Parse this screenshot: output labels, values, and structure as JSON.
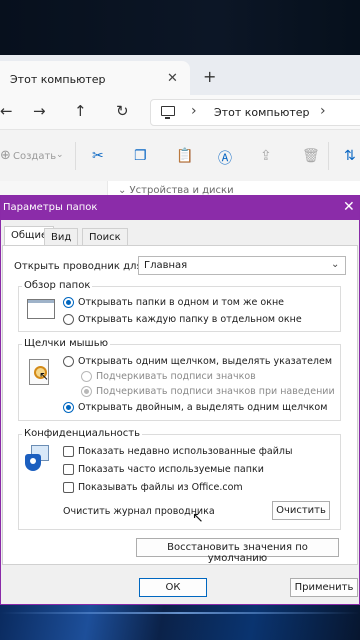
{
  "explorer": {
    "tab_title": "Этот компьютер",
    "tab_close": "✕",
    "new_tab": "+",
    "nav": {
      "back": "←",
      "forward": "→",
      "up": "↑",
      "refresh": "↻"
    },
    "address": {
      "separator": "›",
      "location": "Этот компьютер"
    },
    "toolbar": {
      "create_label": "Создать",
      "icons": [
        "cut-icon",
        "copy-icon",
        "paste-icon",
        "rename-icon",
        "share-icon",
        "delete-icon",
        "sort-icon"
      ]
    },
    "devices_label": "⌄ Устройства и диски"
  },
  "dialog": {
    "title": "Параметры папок",
    "close": "✕",
    "tabs": [
      "Общие",
      "Вид",
      "Поиск"
    ],
    "open_explorer_label": "Открыть проводник для:",
    "open_explorer_value": "Главная",
    "browse_group": {
      "title": "Обзор папок",
      "options": [
        {
          "label": "Открывать папки в одном и том же окне",
          "checked": true
        },
        {
          "label": "Открывать каждую папку в отдельном окне",
          "checked": false
        }
      ]
    },
    "click_group": {
      "title": "Щелчки мышью",
      "single_click": "Открывать одним щелчком, выделять указателем",
      "underline_always": "Подчеркивать подписи значков",
      "underline_hover": "Подчеркивать подписи значков при наведении",
      "double_click": "Открывать двойным, а выделять одним щелчком",
      "selected": "double_click"
    },
    "privacy_group": {
      "title": "Конфиденциальность",
      "options": [
        {
          "label": "Показать недавно использованные файлы",
          "checked": false
        },
        {
          "label": "Показать часто используемые папки",
          "checked": false
        },
        {
          "label": "Показывать файлы из Office.com",
          "checked": false
        }
      ],
      "clear_label": "Очистить журнал проводника",
      "clear_button": "Очистить"
    },
    "restore_defaults": "Восстановить значения по умолчанию",
    "ok": "ОК",
    "apply": "Применить"
  },
  "colors": {
    "titlebar": "#8b2ca9",
    "accent": "#0067c0"
  }
}
